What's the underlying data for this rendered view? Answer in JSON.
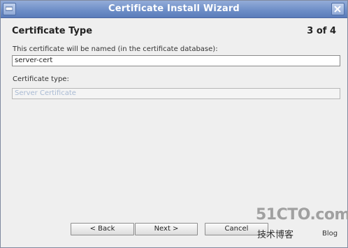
{
  "window": {
    "title": "Certificate Install Wizard"
  },
  "header": {
    "title": "Certificate Type",
    "step": "3 of 4"
  },
  "form": {
    "name_label": "This certificate will be named (in the certificate database):",
    "name_value": "server-cert",
    "type_label": "Certificate type:",
    "type_value": "Server Certificate"
  },
  "buttons": {
    "back": "< Back",
    "next": "Next >",
    "cancel": "Cancel"
  },
  "watermark": {
    "site": "51CTO.com",
    "cn": "技术博客",
    "blog": "Blog"
  },
  "icons": {
    "titlebar_left": "window-menu-icon",
    "titlebar_right": "close-icon"
  },
  "colors": {
    "titlebar": "#6f8fc8",
    "background": "#efefef"
  }
}
